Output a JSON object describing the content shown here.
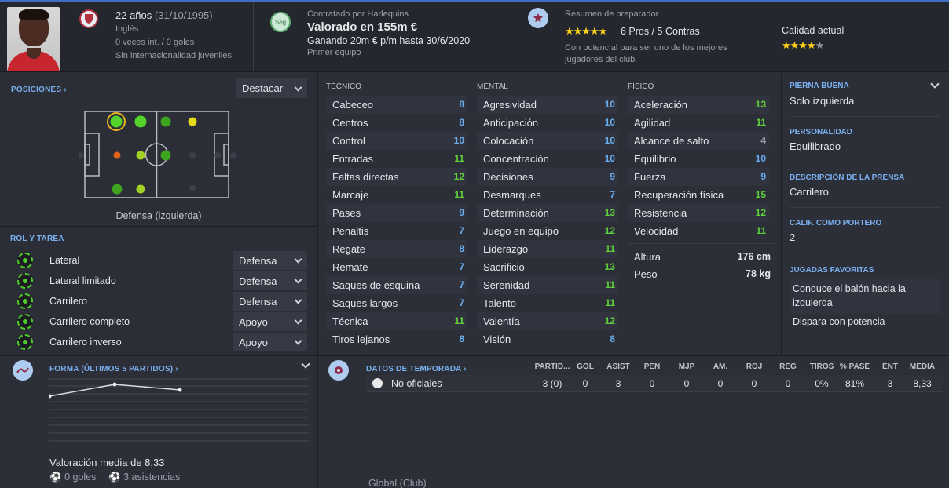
{
  "header": {
    "age_label": "22 años",
    "dob": "(31/10/1995)",
    "nationality": "Inglés",
    "caps": "0 veces int. / 0 goles",
    "youth_caps": "Sin internacionalidad juveniles",
    "contract_club": "Contratado por Harlequins",
    "value": "Valorado en 155m €",
    "wage": "Ganando 20m € p/m hasta 30/6/2020",
    "squad": "Primer equipo",
    "seg_badge": "Seg",
    "coach_title": "Resumen de preparador",
    "pros_cons": "6 Pros / 5 Contras",
    "coach_note": "Con potencial para ser uno de los mejores jugadores del club.",
    "current_ability_label": "Calidad actual",
    "potential_stars": 5,
    "current_stars": 4,
    "current_stars_half": true
  },
  "positions": {
    "title": "POSICIONES",
    "button": "Destacar",
    "caption": "Defensa (izquierda)"
  },
  "roles": {
    "title": "ROL Y TAREA",
    "items": [
      {
        "name": "Lateral",
        "duty": "Defensa"
      },
      {
        "name": "Lateral limitado",
        "duty": "Defensa"
      },
      {
        "name": "Carrilero",
        "duty": "Defensa"
      },
      {
        "name": "Carrilero completo",
        "duty": "Apoyo"
      },
      {
        "name": "Carrilero inverso",
        "duty": "Apoyo"
      }
    ]
  },
  "technical": {
    "title": "TÉCNICO",
    "attrs": [
      {
        "name": "Cabeceo",
        "value": "8",
        "color": "blue"
      },
      {
        "name": "Centros",
        "value": "8",
        "color": "blue"
      },
      {
        "name": "Control",
        "value": "10",
        "color": "blue"
      },
      {
        "name": "Entradas",
        "value": "11",
        "color": "green"
      },
      {
        "name": "Faltas directas",
        "value": "12",
        "color": "green"
      },
      {
        "name": "Marcaje",
        "value": "11",
        "color": "green"
      },
      {
        "name": "Pases",
        "value": "9",
        "color": "blue"
      },
      {
        "name": "Penaltis",
        "value": "7",
        "color": "blue"
      },
      {
        "name": "Regate",
        "value": "8",
        "color": "blue"
      },
      {
        "name": "Remate",
        "value": "7",
        "color": "blue"
      },
      {
        "name": "Saques de esquina",
        "value": "7",
        "color": "blue"
      },
      {
        "name": "Saques largos",
        "value": "7",
        "color": "blue"
      },
      {
        "name": "Técnica",
        "value": "11",
        "color": "green"
      },
      {
        "name": "Tiros lejanos",
        "value": "8",
        "color": "blue"
      }
    ]
  },
  "mental": {
    "title": "MENTAL",
    "attrs": [
      {
        "name": "Agresividad",
        "value": "10",
        "color": "blue"
      },
      {
        "name": "Anticipación",
        "value": "10",
        "color": "blue"
      },
      {
        "name": "Colocación",
        "value": "10",
        "color": "blue"
      },
      {
        "name": "Concentración",
        "value": "10",
        "color": "blue"
      },
      {
        "name": "Decisiones",
        "value": "9",
        "color": "blue"
      },
      {
        "name": "Desmarques",
        "value": "7",
        "color": "blue"
      },
      {
        "name": "Determinación",
        "value": "13",
        "color": "green"
      },
      {
        "name": "Juego en equipo",
        "value": "12",
        "color": "green"
      },
      {
        "name": "Liderazgo",
        "value": "11",
        "color": "green"
      },
      {
        "name": "Sacrificio",
        "value": "13",
        "color": "green"
      },
      {
        "name": "Serenidad",
        "value": "11",
        "color": "green"
      },
      {
        "name": "Talento",
        "value": "11",
        "color": "green"
      },
      {
        "name": "Valentía",
        "value": "12",
        "color": "green"
      },
      {
        "name": "Visión",
        "value": "8",
        "color": "blue"
      }
    ]
  },
  "physical": {
    "title": "FÍSICO",
    "attrs": [
      {
        "name": "Aceleración",
        "value": "13",
        "color": "green"
      },
      {
        "name": "Agilidad",
        "value": "11",
        "color": "green"
      },
      {
        "name": "Alcance de salto",
        "value": "4",
        "color": "grey"
      },
      {
        "name": "Equilibrio",
        "value": "10",
        "color": "blue"
      },
      {
        "name": "Fuerza",
        "value": "9",
        "color": "blue"
      },
      {
        "name": "Recuperación física",
        "value": "15",
        "color": "green"
      },
      {
        "name": "Resistencia",
        "value": "12",
        "color": "green"
      },
      {
        "name": "Velocidad",
        "value": "11",
        "color": "green"
      }
    ],
    "height_label": "Altura",
    "height_value": "176 cm",
    "weight_label": "Peso",
    "weight_value": "78 kg"
  },
  "info": {
    "foot_label": "PIERNA BUENA",
    "foot_value": "Solo izquierda",
    "personality_label": "PERSONALIDAD",
    "personality_value": "Equilibrado",
    "media_label": "DESCRIPCIÓN DE LA PRENSA",
    "media_value": "Carrilero",
    "gk_label": "CALIF. COMO PORTERO",
    "gk_value": "2",
    "moves_label": "JUGADAS FAVORITAS",
    "moves": [
      "Conduce el balón hacia la izquierda",
      "Dispara con potencia"
    ]
  },
  "form": {
    "title": "FORMA (ÚLTIMOS 5 PARTIDOS)",
    "avg": "Valoración media de 8,33",
    "goals": "0 goles",
    "assists": "3 asistencias"
  },
  "season": {
    "title": "DATOS DE TEMPORADA",
    "headers": [
      "PARTID...",
      "GOL",
      "ASIST",
      "PEN",
      "MJP",
      "AM.",
      "ROJ",
      "REG",
      "TIROS",
      "% PASE",
      "ENT",
      "MEDIA"
    ],
    "row_label": "No oficiales",
    "row_values": [
      "3 (0)",
      "0",
      "3",
      "0",
      "0",
      "0",
      "0",
      "0",
      "0%",
      "81%",
      "3",
      "8,33"
    ],
    "footer": "Global (Club)"
  },
  "colors": {
    "green": "#5fd23b",
    "blue": "#6aaef0",
    "grey": "#9aa0ab",
    "accent": "#3f6fc2"
  }
}
